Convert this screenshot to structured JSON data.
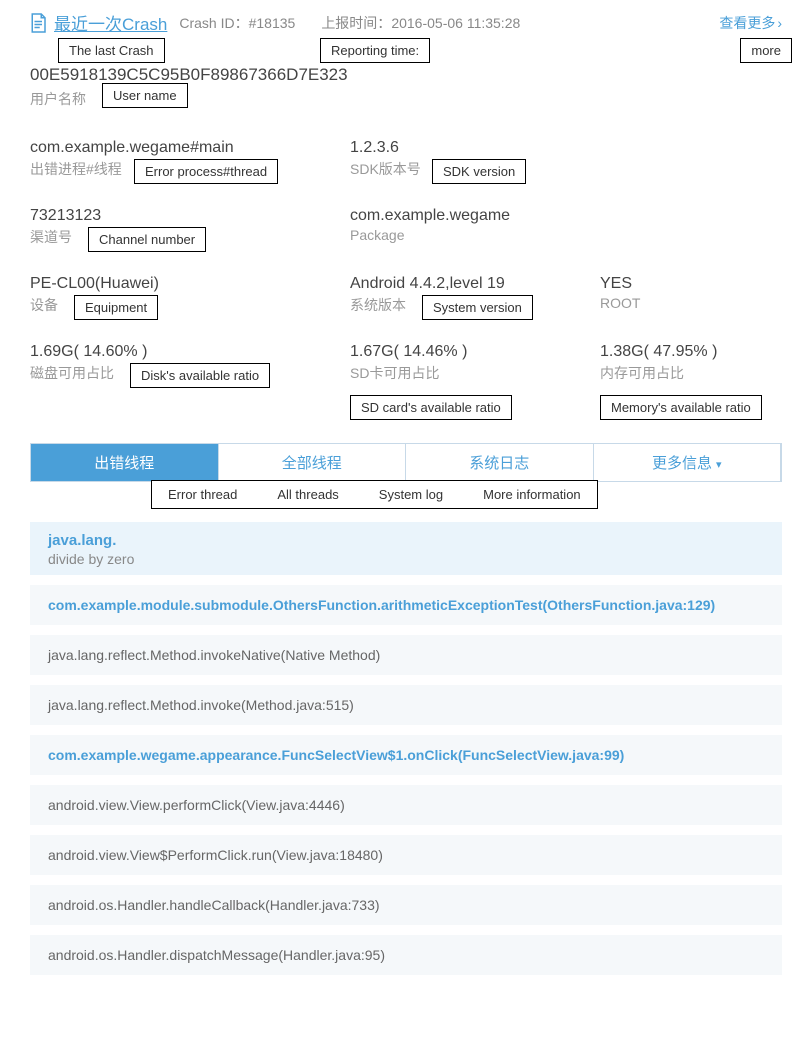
{
  "header": {
    "title": "最近一次Crash",
    "crash_id_label": "Crash ID：#18135",
    "report_time_label": "上报时间：",
    "report_time_value": "2016-05-06 11:35:28",
    "view_more": "查看更多"
  },
  "annotations": {
    "last_crash": "The last Crash",
    "reporting_time": "Reporting time:",
    "more": "more",
    "user_name": "User name",
    "error_process_thread": "Error process#thread",
    "sdk_version": "SDK version",
    "channel_number": "Channel number",
    "equipment": "Equipment",
    "system_version": "System version",
    "disk_ratio": "Disk's available ratio",
    "sd_ratio": "SD card's available ratio",
    "memory_ratio": "Memory's available ratio",
    "error_thread": "Error thread",
    "all_threads": "All threads",
    "system_log": "System log",
    "more_info": "More information"
  },
  "hash": "00E5918139C5C95B0F89867366D7E323",
  "user_name_label": "用户名称",
  "fields": {
    "process": {
      "value": "com.example.wegame#main",
      "label": "出错进程#线程"
    },
    "sdk": {
      "value": "1.2.3.6",
      "label": "SDK版本号"
    },
    "channel": {
      "value": "73213123",
      "label": "渠道号"
    },
    "package": {
      "value": "com.example.wegame",
      "label": "Package"
    },
    "device": {
      "value": "PE-CL00(Huawei)",
      "label": "设备"
    },
    "system": {
      "value": "Android 4.4.2,level 19",
      "label": "系统版本"
    },
    "root": {
      "value": "YES",
      "label": "ROOT"
    },
    "disk": {
      "value": "1.69G( 14.60% )",
      "label": "磁盘可用占比"
    },
    "sd": {
      "value": "1.67G( 14.46% )",
      "label": "SD卡可用占比"
    },
    "memory": {
      "value": "1.38G( 47.95% )",
      "label": "内存可用占比"
    }
  },
  "tabs": {
    "error_thread": "出错线程",
    "all_threads": "全部线程",
    "system_log": "系统日志",
    "more_info": "更多信息"
  },
  "stack": {
    "exception": "java.lang.",
    "message": "divide by zero",
    "frames": [
      {
        "text": "com.example.module.submodule.OthersFunction.arithmeticExceptionTest(OthersFunction.java:129)",
        "bold": true
      },
      {
        "text": "java.lang.reflect.Method.invokeNative(Native Method)",
        "bold": false
      },
      {
        "text": "java.lang.reflect.Method.invoke(Method.java:515)",
        "bold": false
      },
      {
        "text": "com.example.wegame.appearance.FuncSelectView$1.onClick(FuncSelectView.java:99)",
        "bold": true
      },
      {
        "text": "android.view.View.performClick(View.java:4446)",
        "bold": false
      },
      {
        "text": "android.view.View$PerformClick.run(View.java:18480)",
        "bold": false
      },
      {
        "text": "android.os.Handler.handleCallback(Handler.java:733)",
        "bold": false
      },
      {
        "text": "android.os.Handler.dispatchMessage(Handler.java:95)",
        "bold": false
      }
    ]
  }
}
